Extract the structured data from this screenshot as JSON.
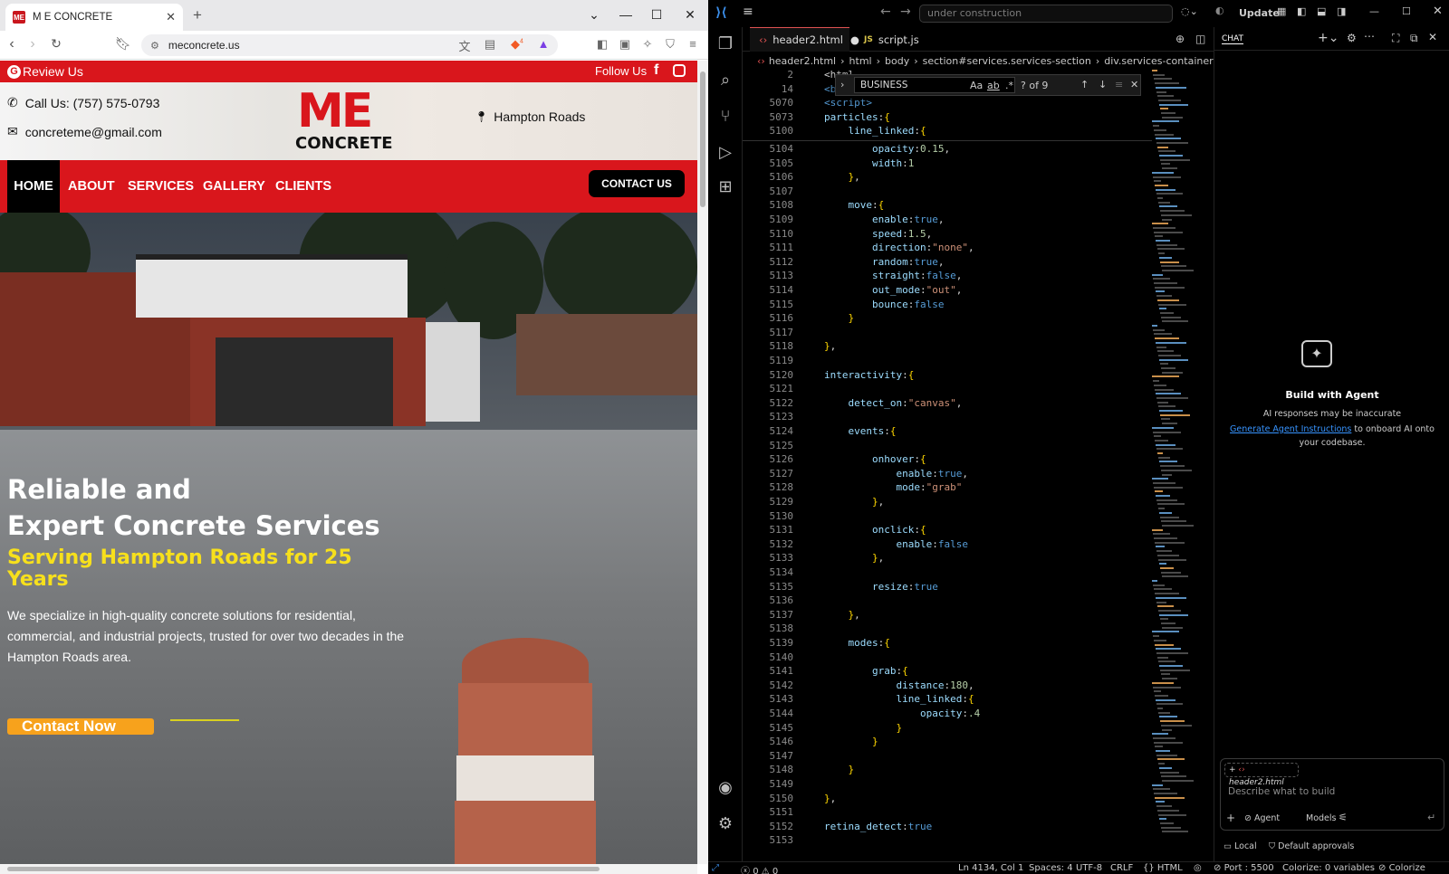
{
  "browser": {
    "tab_title": "M E CONCRETE",
    "tab_favicon": "ME",
    "url": "meconcrete.us",
    "shield_count": "4"
  },
  "site": {
    "review_label": "Review Us",
    "follow_label": "Follow Us",
    "phone": "Call Us: (757) 575-0793",
    "email": "concreteme@gmail.com",
    "location": "Hampton Roads",
    "logo_me": "ME",
    "logo_concrete": "CONCRETE",
    "nav": [
      "HOME",
      "ABOUT",
      "SERVICES",
      "GALLERY",
      "CLIENTS"
    ],
    "contact_button": "CONTACT US",
    "hero_line1": "Reliable and",
    "hero_line2": "Expert Concrete Services",
    "hero_subtitle": "Serving Hampton Roads for 25 Years",
    "hero_desc": "We specialize in high-quality concrete solutions for residential, commercial, and industrial projects, trusted for over two decades in the Hampton Roads area.",
    "cta": "Contact Now",
    "brand_red": "#d9161c",
    "accent_yellow": "#f7e01c",
    "cta_orange": "#f7a21c"
  },
  "vscode": {
    "command_center": "under construction",
    "update": "Update",
    "tabs": [
      "header2.html",
      "script.js"
    ],
    "breadcrumbs": [
      "header2.html",
      "html",
      "body",
      "section#services.services-section",
      "div.services-container"
    ],
    "find": {
      "query": "BUSINESS",
      "count": "? of 9",
      "case": "Aa",
      "word": "ab",
      "regex": ".*"
    },
    "chat": {
      "header": "CHAT",
      "title": "Build with Agent",
      "note": "AI responses may be inaccurate",
      "link": "Generate Agent Instructions",
      "after_link": "to onboard AI onto your codebase.",
      "context_file": "header2.html",
      "placeholder": "Describe what to build",
      "mode": "Agent",
      "models": "Models",
      "local": "Local",
      "approvals": "Default approvals"
    },
    "status": {
      "errors": "0",
      "warnings": "0",
      "position": "Ln 4134, Col 1",
      "spaces": "Spaces: 4",
      "encoding": "UTF-8",
      "eol": "CRLF",
      "language": "HTML",
      "port": "Port : 5500",
      "colorize_vars": "Colorize: 0 variables",
      "colorize": "Colorize"
    },
    "sticky": [
      {
        "n": "2",
        "t": "<html"
      },
      {
        "n": "14",
        "t": "<body>"
      },
      {
        "n": "5070",
        "t": "<script>"
      },
      {
        "n": "5073",
        "t": "particles:{"
      },
      {
        "n": "5100",
        "t": "    line_linked:{"
      }
    ],
    "lines": [
      {
        "n": "5104",
        "t": "        opacity:0.15,"
      },
      {
        "n": "5105",
        "t": "        width:1"
      },
      {
        "n": "5106",
        "t": "    },"
      },
      {
        "n": "5107",
        "t": ""
      },
      {
        "n": "5108",
        "t": "    move:{"
      },
      {
        "n": "5109",
        "t": "        enable:true,"
      },
      {
        "n": "5110",
        "t": "        speed:1.5,"
      },
      {
        "n": "5111",
        "t": "        direction:\"none\","
      },
      {
        "n": "5112",
        "t": "        random:true,"
      },
      {
        "n": "5113",
        "t": "        straight:false,"
      },
      {
        "n": "5114",
        "t": "        out_mode:\"out\","
      },
      {
        "n": "5115",
        "t": "        bounce:false"
      },
      {
        "n": "5116",
        "t": "    }"
      },
      {
        "n": "5117",
        "t": ""
      },
      {
        "n": "5118",
        "t": "},"
      },
      {
        "n": "5119",
        "t": ""
      },
      {
        "n": "5120",
        "t": "interactivity:{"
      },
      {
        "n": "5121",
        "t": ""
      },
      {
        "n": "5122",
        "t": "    detect_on:\"canvas\","
      },
      {
        "n": "5123",
        "t": ""
      },
      {
        "n": "5124",
        "t": "    events:{"
      },
      {
        "n": "5125",
        "t": ""
      },
      {
        "n": "5126",
        "t": "        onhover:{"
      },
      {
        "n": "5127",
        "t": "            enable:true,"
      },
      {
        "n": "5128",
        "t": "            mode:\"grab\""
      },
      {
        "n": "5129",
        "t": "        },"
      },
      {
        "n": "5130",
        "t": ""
      },
      {
        "n": "5131",
        "t": "        onclick:{"
      },
      {
        "n": "5132",
        "t": "            enable:false"
      },
      {
        "n": "5133",
        "t": "        },"
      },
      {
        "n": "5134",
        "t": ""
      },
      {
        "n": "5135",
        "t": "        resize:true"
      },
      {
        "n": "5136",
        "t": ""
      },
      {
        "n": "5137",
        "t": "    },"
      },
      {
        "n": "5138",
        "t": ""
      },
      {
        "n": "5139",
        "t": "    modes:{"
      },
      {
        "n": "5140",
        "t": ""
      },
      {
        "n": "5141",
        "t": "        grab:{"
      },
      {
        "n": "5142",
        "t": "            distance:180,"
      },
      {
        "n": "5143",
        "t": "            line_linked:{"
      },
      {
        "n": "5144",
        "t": "                opacity:.4"
      },
      {
        "n": "5145",
        "t": "            }"
      },
      {
        "n": "5146",
        "t": "        }"
      },
      {
        "n": "5147",
        "t": ""
      },
      {
        "n": "5148",
        "t": "    }"
      },
      {
        "n": "5149",
        "t": ""
      },
      {
        "n": "5150",
        "t": "},"
      },
      {
        "n": "5151",
        "t": ""
      },
      {
        "n": "5152",
        "t": "retina_detect:true"
      },
      {
        "n": "5153",
        "t": ""
      }
    ]
  }
}
